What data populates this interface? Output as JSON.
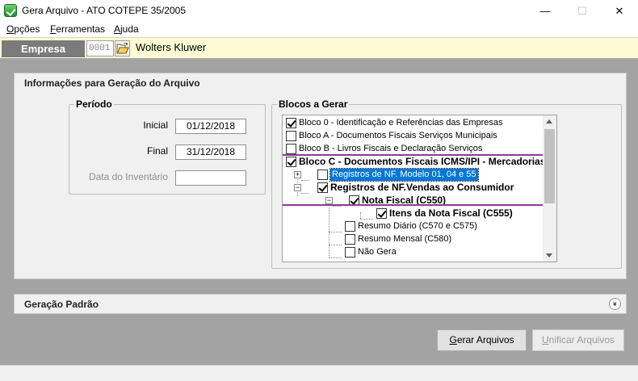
{
  "window": {
    "title": "Gera Arquivo - ATO COTEPE 35/2005",
    "minimize_glyph": "—",
    "maximize_glyph": "☐",
    "close_glyph": "✕"
  },
  "menu": [
    {
      "label_u": "O",
      "label_rest": "pções"
    },
    {
      "label_u": "F",
      "label_rest": "erramentas"
    },
    {
      "label_u": "A",
      "label_rest": "juda"
    }
  ],
  "empresa": {
    "label": "Empresa",
    "code": "0001",
    "name": "Wolters Kluwer"
  },
  "panel": {
    "title": "Informações para Geração do Arquivo"
  },
  "periodo": {
    "title": "Período",
    "inicial_label": "Inicial",
    "inicial_value": "01/12/2018",
    "final_label": "Final",
    "final_value": "31/12/2018",
    "inventario_label": "Data do Inventário",
    "inventario_value": ""
  },
  "blocos": {
    "title": "Blocos a Gerar",
    "items": [
      {
        "label": "Bloco 0 - Identificação e Referências das Empresas",
        "checked": true
      },
      {
        "label": "Bloco A - Documentos Fiscais Serviços Municipais",
        "checked": false
      },
      {
        "label": "Bloco B - Livros Fiscais e Declaração Serviços",
        "checked": false
      },
      {
        "label": "Bloco C - Documentos Fiscais ICMS/IPI - Mercadorias",
        "checked": true
      },
      {
        "label": "Registros de NF. Modelo 01, 04 e 55",
        "checked": false
      },
      {
        "label": "Registros de NF.Vendas ao Consumidor",
        "checked": true
      },
      {
        "label": "Nota Fiscal  (C550)",
        "checked": true
      },
      {
        "label": "Itens da Nota Fiscal  (C555)",
        "checked": true
      },
      {
        "label": "Resumo Diário  (C570 e C575)",
        "checked": false
      },
      {
        "label": "Resumo Mensal  (C580)",
        "checked": false
      },
      {
        "label": "Não Gera",
        "checked": false
      }
    ]
  },
  "geracao": {
    "title": "Geração Padrão",
    "chevron_glyph": "»"
  },
  "buttons": {
    "gerar_u": "G",
    "gerar_rest": "erar Arquivos",
    "unificar_u": "U",
    "unificar_rest": "nificar Arquivos"
  },
  "colors": {
    "accent_highlight": "#8b3a9b",
    "selection": "#0078d7",
    "empresa_bar": "#fdfbd6",
    "empresa_label_bg": "#7b7b7b",
    "main_bg": "#a3a3a3"
  }
}
